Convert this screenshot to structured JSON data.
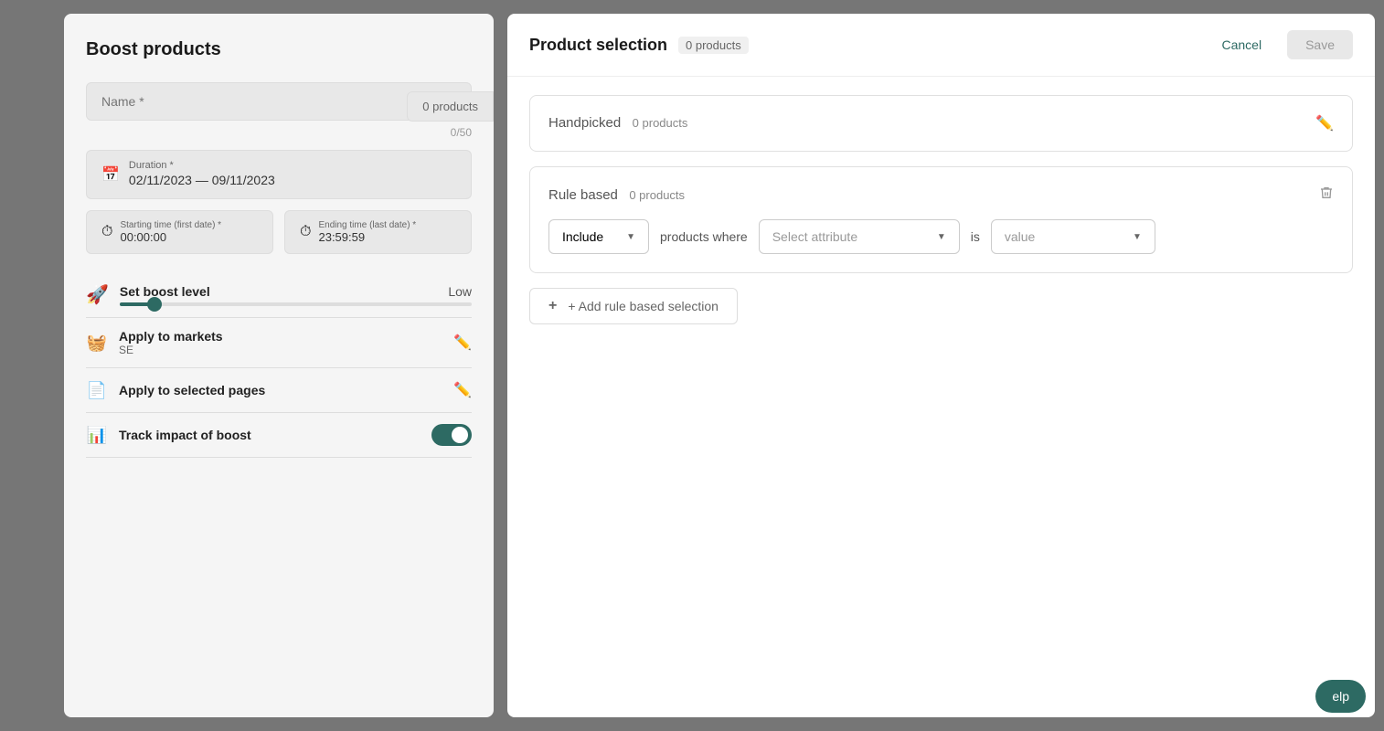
{
  "left_panel": {
    "title": "Boost products",
    "name_field": {
      "placeholder": "Name *",
      "value": "",
      "char_count": "0/50"
    },
    "duration": {
      "label": "Duration *",
      "value": "02/11/2023 — 09/11/2023"
    },
    "starting_time": {
      "label": "Starting time (first date) *",
      "value": "00:00:00"
    },
    "ending_time": {
      "label": "Ending time (last date) *",
      "value": "23:59:59"
    },
    "boost_level": {
      "title": "Set boost level",
      "value": "Low",
      "slider_percent": 10
    },
    "apply_markets": {
      "title": "Apply to markets",
      "subtitle": "SE"
    },
    "apply_pages": {
      "title": "Apply to selected pages"
    },
    "track_boost": {
      "title": "Track impact of boost",
      "enabled": true
    },
    "products_badge": "0 products"
  },
  "modal": {
    "title": "Product selection",
    "products_count": "0 products",
    "cancel_label": "Cancel",
    "save_label": "Save",
    "handpicked": {
      "title": "Handpicked",
      "count": "0 products"
    },
    "rule_based": {
      "title": "Rule based",
      "count": "0 products"
    },
    "rule_row": {
      "include_label": "Include",
      "products_where_label": "products where",
      "attribute_placeholder": "Select attribute",
      "is_label": "is",
      "value_placeholder": "value"
    },
    "add_rule_label": "+ Add rule based selection"
  },
  "help_label": "elp"
}
